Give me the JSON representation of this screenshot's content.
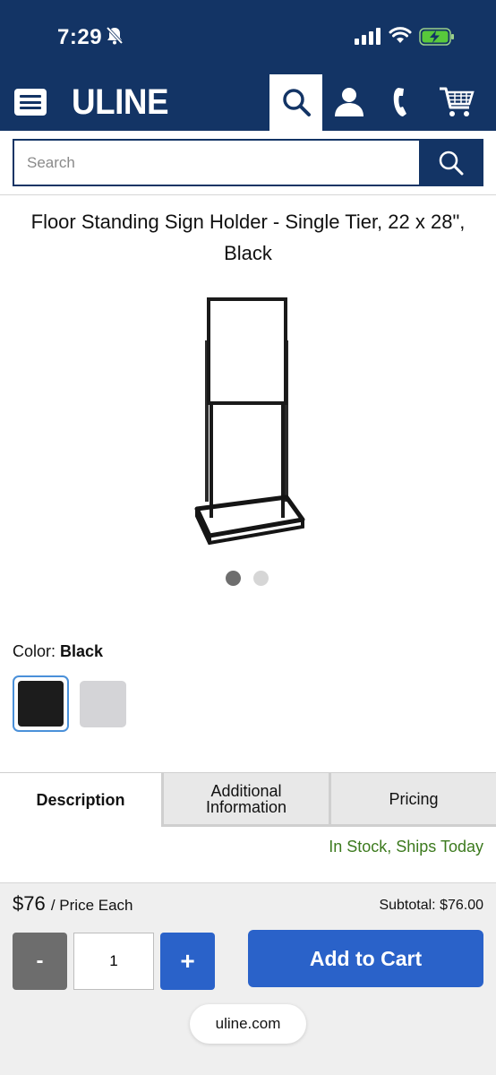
{
  "status_bar": {
    "time": "7:29"
  },
  "header": {
    "logo": "ULINE",
    "icons": [
      "menu-icon",
      "search-icon",
      "user-icon",
      "phone-icon",
      "cart-icon"
    ]
  },
  "search": {
    "placeholder": "Search"
  },
  "product": {
    "title": "Floor Standing Sign Holder - Single Tier, 22 x 28\", Black",
    "image_dots": {
      "count": 2,
      "active_index": 0
    }
  },
  "color": {
    "label": "Color:",
    "selected": "Black",
    "options": [
      {
        "name": "Black",
        "hex": "#1c1c1c",
        "selected": true
      },
      {
        "name": "Gray",
        "hex": "#d4d4d7",
        "selected": false
      }
    ]
  },
  "tabs": [
    {
      "label": "Description",
      "active": true
    },
    {
      "label": "Additional Information",
      "active": false
    },
    {
      "label": "Pricing",
      "active": false
    }
  ],
  "stock_status": "In Stock, Ships Today",
  "cart": {
    "price": "$76",
    "price_unit": "/ Price Each",
    "subtotal_label": "Subtotal:",
    "subtotal_value": "$76.00",
    "minus_label": "-",
    "quantity": "1",
    "plus_label": "+",
    "add_label": "Add to Cart"
  },
  "browser": {
    "url": "uline.com"
  },
  "colors": {
    "brand_navy": "#133465",
    "accent_blue": "#2a62c9",
    "stock_green": "#3c7a1e"
  }
}
